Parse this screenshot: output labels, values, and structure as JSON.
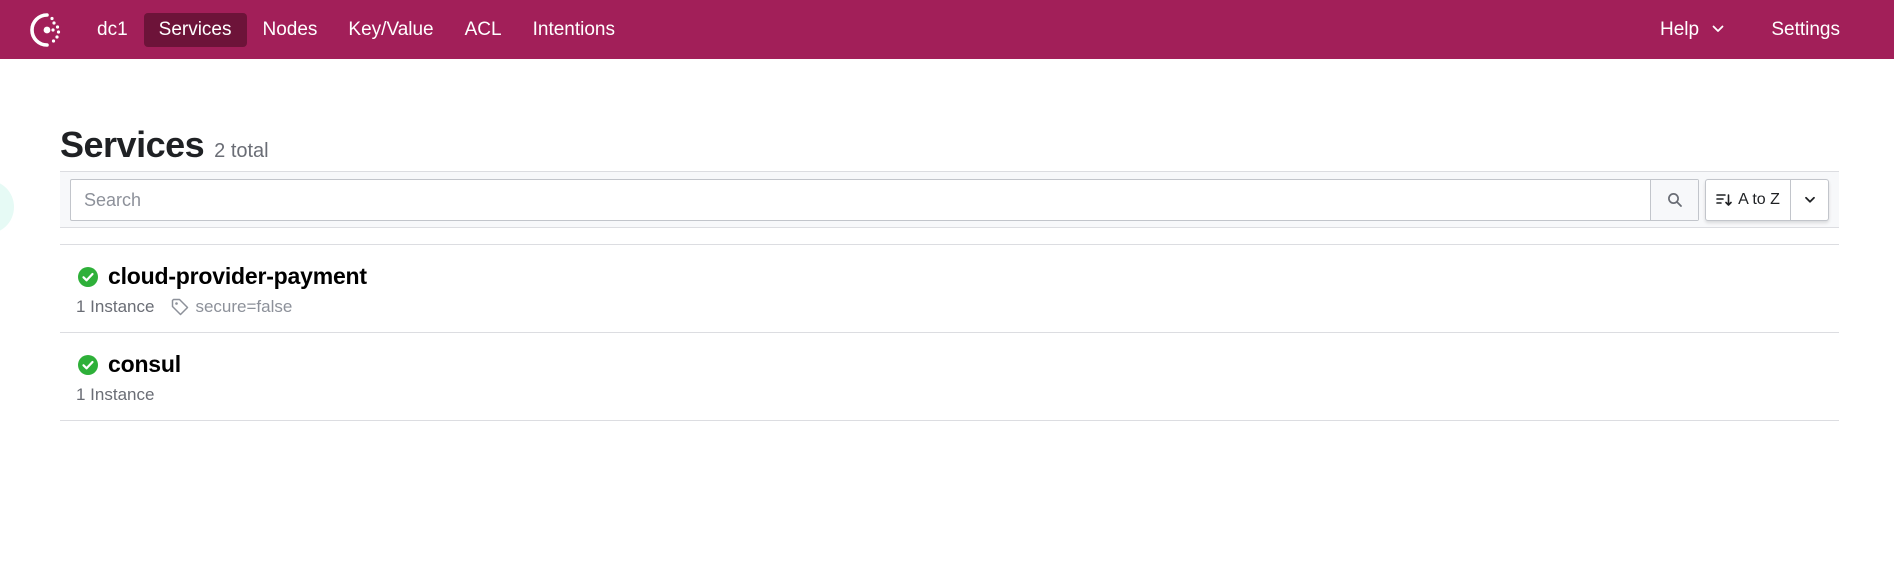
{
  "nav": {
    "datacenter": "dc1",
    "items": [
      {
        "label": "Services",
        "active": true
      },
      {
        "label": "Nodes",
        "active": false
      },
      {
        "label": "Key/Value",
        "active": false
      },
      {
        "label": "ACL",
        "active": false
      },
      {
        "label": "Intentions",
        "active": false
      }
    ],
    "help_label": "Help",
    "settings_label": "Settings"
  },
  "page": {
    "title": "Services",
    "count": "2 total"
  },
  "search": {
    "placeholder": "Search",
    "value": ""
  },
  "sort": {
    "label": "A to Z"
  },
  "services": [
    {
      "name": "cloud-provider-payment",
      "instances": "1 Instance",
      "tag": "secure=false",
      "health": "passing"
    },
    {
      "name": "consul",
      "instances": "1 Instance",
      "tag": "",
      "health": "passing"
    }
  ],
  "colors": {
    "brand": "#a21f59",
    "brand_active": "#6d1339",
    "passing": "#2eb039"
  }
}
